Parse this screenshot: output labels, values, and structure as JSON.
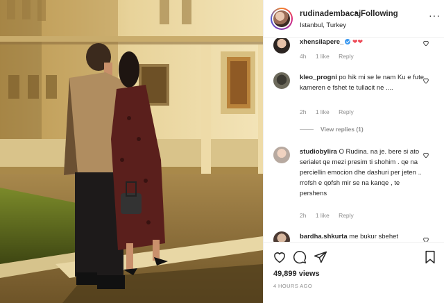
{
  "header": {
    "username": "rudinadembacaj",
    "separator": "•",
    "follow_status": "Following",
    "location": "Istanbul, Turkey",
    "more": "···"
  },
  "comments": [
    {
      "username": "xhensilapere_",
      "text": "",
      "emoji": "❤❤",
      "time": "4h",
      "likes": "1 like",
      "reply": "Reply",
      "verified": true
    },
    {
      "username": "kleo_progni",
      "text": "po hik mi se le nam Ku e fute kameren e fshet te tullacit ne ....",
      "time": "2h",
      "likes": "1 like",
      "reply": "Reply",
      "view_replies": "View replies (1)"
    },
    {
      "username": "studiobylira",
      "text": "O Rudina. na je. bere si ato serialet qe mezi presim ti shohim . qe na perciellin emocion dhe dashuri per jeten .. rrofsh e qofsh mir se na kanqe , te pershens",
      "time": "2h",
      "likes": "1 like",
      "reply": "Reply"
    },
    {
      "username": "bardha.shkurta",
      "text": "me bukur sbehet"
    }
  ],
  "actions": {
    "views": "49,899 views",
    "time_ago": "4 HOURS AGO"
  },
  "colors": {
    "accent_heart": "#ed4956",
    "secondary_text": "#8e8e8e",
    "primary_text": "#262626",
    "verified": "#3897f0"
  },
  "icons": [
    "heart-icon",
    "comment-icon",
    "share-icon",
    "bookmark-icon",
    "more-icon",
    "verified-icon"
  ]
}
